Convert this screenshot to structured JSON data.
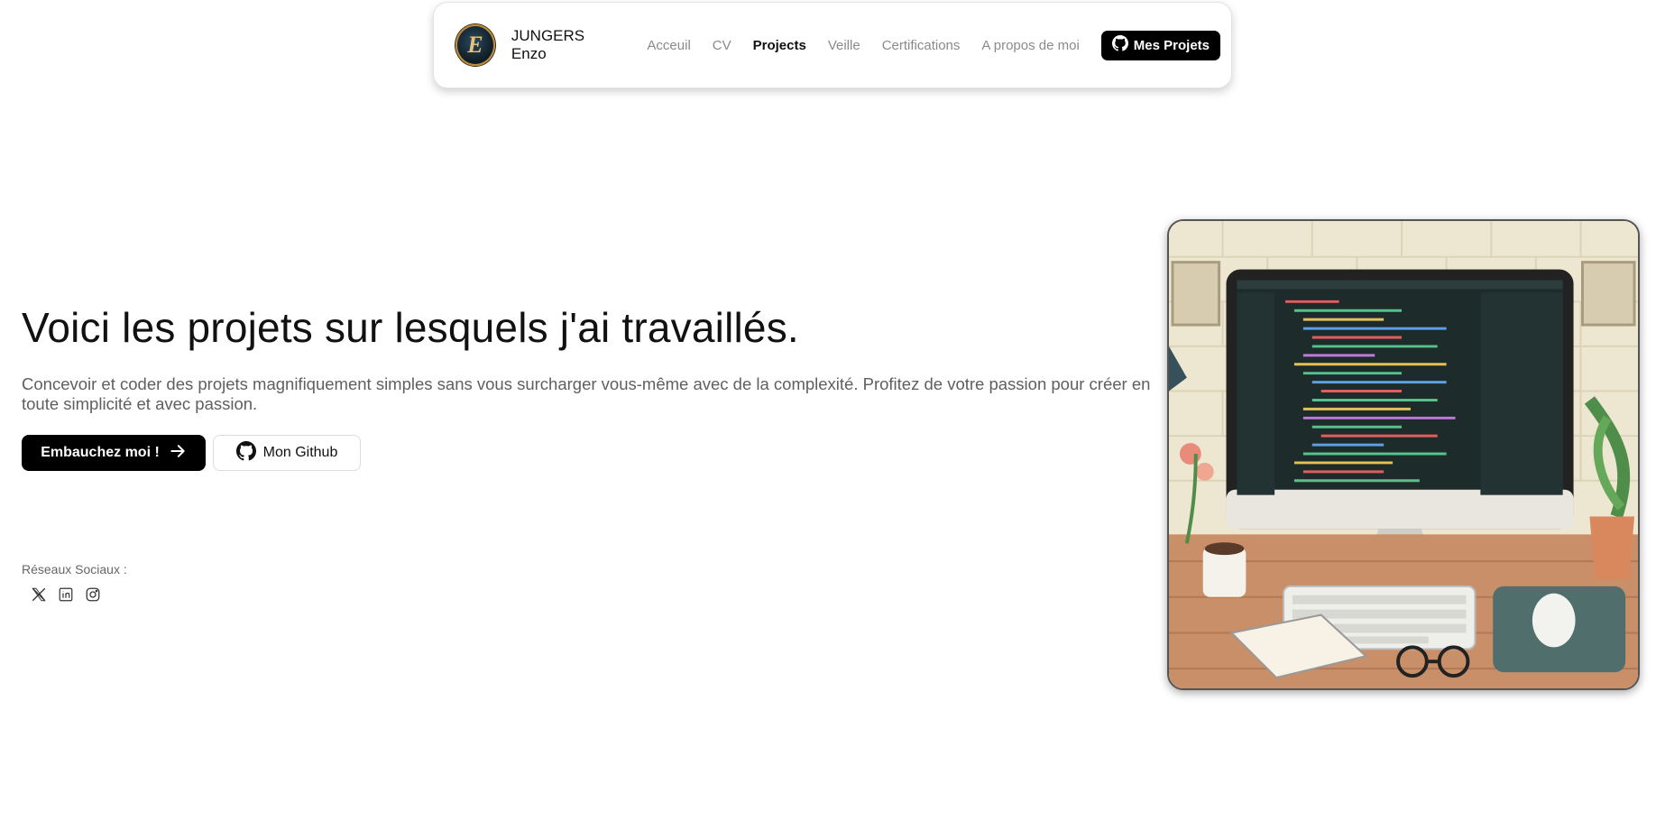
{
  "header": {
    "logo_letter": "E",
    "brand": "JUNGERS Enzo",
    "nav": [
      {
        "label": "Acceuil",
        "active": false
      },
      {
        "label": "CV",
        "active": false
      },
      {
        "label": "Projects",
        "active": true
      },
      {
        "label": "Veille",
        "active": false
      },
      {
        "label": "Certifications",
        "active": false
      },
      {
        "label": "A propos de moi",
        "active": false
      }
    ],
    "github_button": "Mes Projets"
  },
  "hero": {
    "title": "Voici les projets sur lesquels j'ai travaillés.",
    "subtitle": "Concevoir et coder des projets magnifiquement simples sans vous surcharger vous-même avec de la complexité. Profitez de votre passion pour créer en toute simplicité et avec passion.",
    "primary_button": "Embauchez moi !",
    "secondary_button": "Mon Github"
  },
  "social": {
    "label": "Réseaux Sociaux :",
    "icons": [
      "x-icon",
      "linkedin-icon",
      "instagram-icon"
    ]
  },
  "colors": {
    "primary": "#000000",
    "muted_text": "#8a8a8a",
    "body_text": "#5f5f5f"
  }
}
